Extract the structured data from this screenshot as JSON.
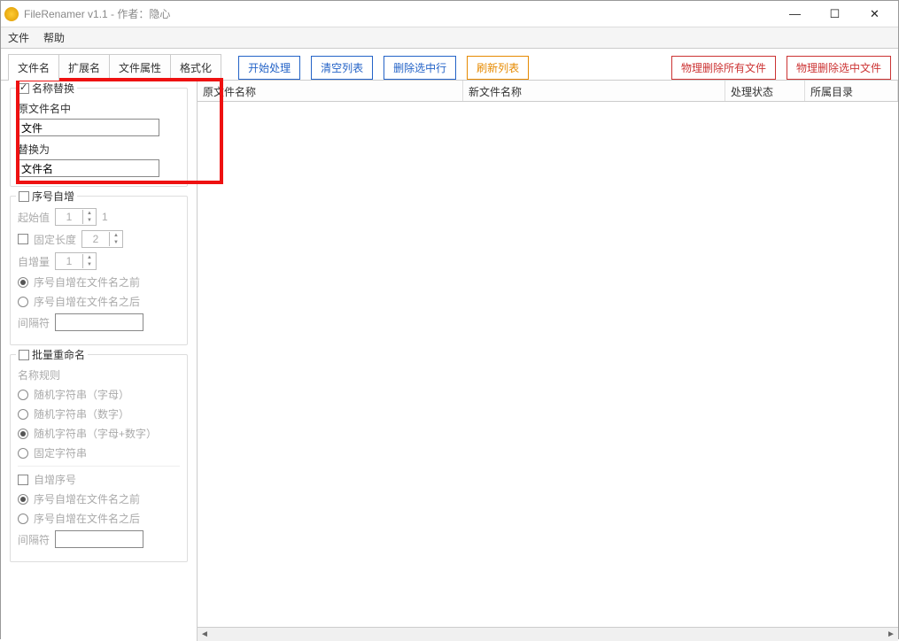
{
  "window": {
    "title": "FileRenamer v1.1 - 作者：隐心"
  },
  "menu": {
    "file": "文件",
    "help": "帮助"
  },
  "tabs": {
    "filename": "文件名",
    "ext": "扩展名",
    "attr": "文件属性",
    "format": "格式化"
  },
  "actions": {
    "start": "开始处理",
    "clear": "清空列表",
    "delsel": "删除选中行",
    "refresh": "刷新列表",
    "delall": "物理删除所有文件",
    "delselphys": "物理删除选中文件"
  },
  "replace": {
    "legend": "名称替换",
    "label_from": "原文件名中",
    "value_from": "文件",
    "label_to": "替换为",
    "value_to": "文件名"
  },
  "seq": {
    "legend": "序号自增",
    "start_label": "起始值",
    "start_val": "1",
    "start_suffix": "1",
    "fixed_label": "固定长度",
    "fixed_val": "2",
    "step_label": "自增量",
    "step_val": "1",
    "before": "序号自增在文件名之前",
    "after": "序号自增在文件名之后",
    "sep_label": "间隔符"
  },
  "batch": {
    "legend": "批量重命名",
    "rule_label": "名称规则",
    "rand_alpha": "随机字符串（字母）",
    "rand_num": "随机字符串（数字）",
    "rand_mix": "随机字符串（字母+数字）",
    "fixed_str": "固定字符串",
    "autoseq": "自增序号",
    "before": "序号自增在文件名之前",
    "after": "序号自增在文件名之后",
    "sep_label": "间隔符"
  },
  "table": {
    "col1": "原文件名称",
    "col2": "新文件名称",
    "col3": "处理状态",
    "col4": "所属目录"
  }
}
